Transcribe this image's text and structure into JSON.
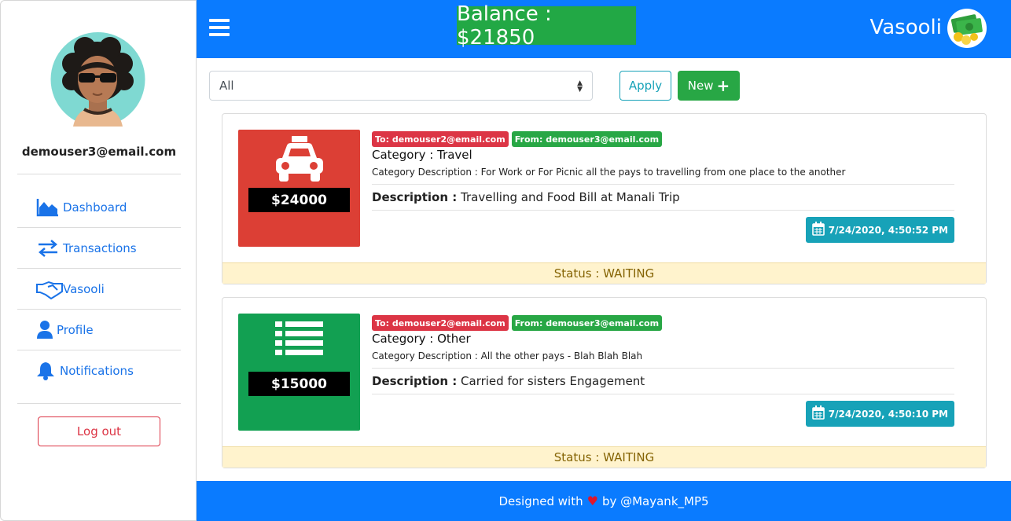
{
  "user": {
    "email": "demouser3@email.com"
  },
  "sidebar": {
    "items": [
      {
        "label": "Dashboard",
        "icon": "area-chart-icon"
      },
      {
        "label": "Transactions",
        "icon": "exchange-icon"
      },
      {
        "label": "Vasooli",
        "icon": "handshake-icon"
      },
      {
        "label": "Profile",
        "icon": "user-icon"
      },
      {
        "label": "Notifications",
        "icon": "bell-icon"
      }
    ],
    "logout_label": "Log out"
  },
  "header": {
    "balance": "Balance : $21850",
    "brand": "Vasooli"
  },
  "filter": {
    "selected": "All",
    "apply_label": "Apply",
    "new_label": "New"
  },
  "transactions": [
    {
      "amount": "$24000",
      "tile_color": "#dc3f35",
      "icon": "taxi-icon",
      "to": "To: demouser2@email.com",
      "from": "From: demouser3@email.com",
      "category": "Category : Travel",
      "category_description": "Category Description : For Work or For Picnic all the pays to travelling from one place to the another",
      "description_label": "Description :",
      "description": "Travelling and Food Bill at Manali Trip",
      "date": "7/24/2020, 4:50:52 PM",
      "status": "Status : WAITING"
    },
    {
      "amount": "$15000",
      "tile_color": "#12a052",
      "icon": "list-icon",
      "to": "To: demouser2@email.com",
      "from": "From: demouser3@email.com",
      "category": "Category : Other",
      "category_description": "Category Description : All the other pays - Blah Blah Blah",
      "description_label": "Description :",
      "description": "Carried for sisters Engagement",
      "date": "7/24/2020, 4:50:10 PM",
      "status": "Status : WAITING"
    }
  ],
  "footer": {
    "text_before": "Designed with",
    "text_after": "by @Mayank_MP5"
  },
  "colors": {
    "primary": "#0a7bff",
    "success": "#28a745",
    "danger": "#dc3545",
    "info": "#17a2b8",
    "warning_bg": "#fff3cd"
  }
}
